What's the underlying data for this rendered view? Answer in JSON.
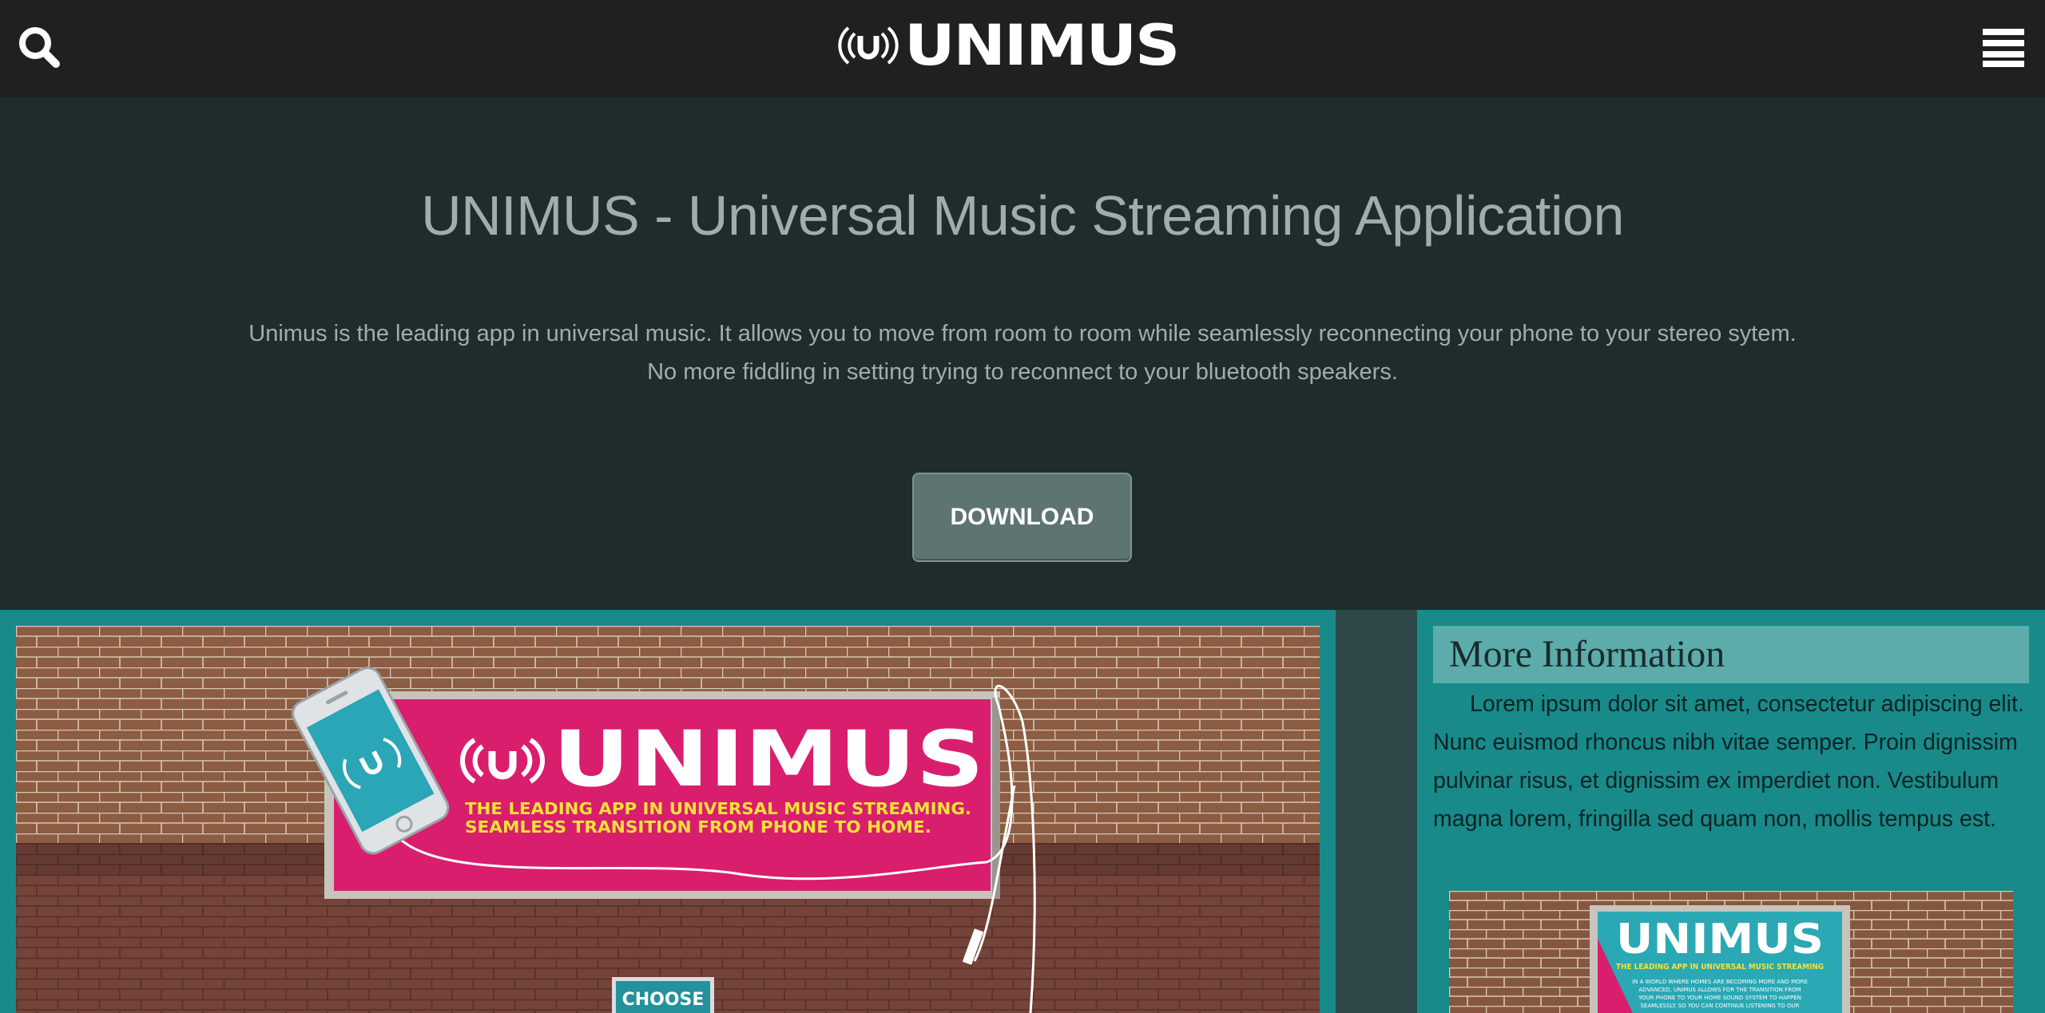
{
  "header": {
    "logo_mark": "(u)",
    "logo_text": "UNIMUS",
    "icons": {
      "search": "search-icon",
      "menu": "hamburger-menu-icon"
    }
  },
  "hero": {
    "title": "UNIMUS - Universal Music Streaming Application",
    "description": "Unimus is the leading app in universal music. It allows you to move from room to room while seamlessly reconnecting your phone to your stereo sytem. No more fiddling in setting trying to reconnect to your bluetooth speakers.",
    "download_label": "DOWNLOAD"
  },
  "billboard": {
    "logo_mark": "(u)",
    "logo_text": "UNIMUS",
    "tagline_line1": "THE LEADING APP IN UNIVERSAL MUSIC STREAMING.",
    "tagline_line2": "SEAMLESS TRANSITION FROM PHONE TO HOME.",
    "choose_label": "CHOOSE"
  },
  "sidebar": {
    "heading": "More Information",
    "body": "Lorem ipsum dolor sit amet, consectetur adipiscing elit. Nunc euismod rhoncus nibh vitae semper. Proin dignissim pulvinar risus, et dignissim ex imperdiet non. Vestibulum magna lorem, fringilla sed quam non, mollis tempus est.",
    "poster": {
      "logo_text": "UNIMUS",
      "tagline": "THE LEADING APP IN UNIVERSAL MUSIC STREAMING",
      "body_line1": "IN A WORLD WHERE HOMES ARE BECOMING MORE AND MORE",
      "body_line2": "ADVANCED, UNIMUS ALLOWS FOR THE TRANSITION FROM",
      "body_line3": "YOUR PHONE TO YOUR HOME SOUND SYSTEM TO HAPPEN",
      "body_line4": "SEAMLESSLY. SO YOU CAN CONTINUE LISTENING TO OUR"
    }
  },
  "colors": {
    "navbar": "#202020",
    "hero_bg": "#1f2c2e",
    "teal": "#188a8a",
    "heading_bg": "#5bacaa",
    "button": "#5e7472",
    "billboard_pink": "#d91e6e",
    "tagline_yellow": "#f3e23a",
    "brick": "#86573f"
  }
}
